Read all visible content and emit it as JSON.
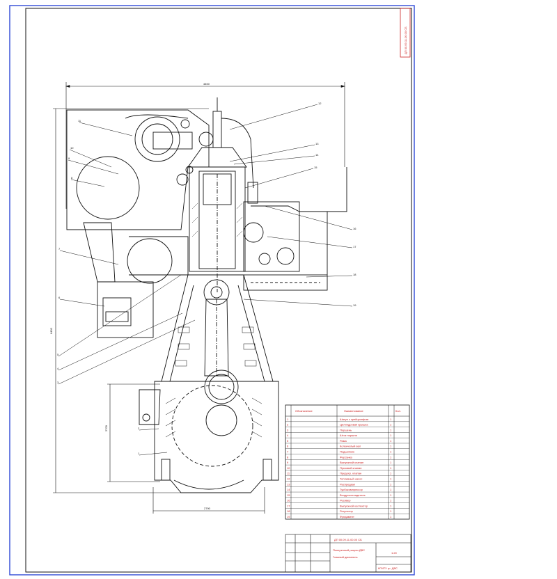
{
  "colors": {
    "outer_frame": "#2f49d6",
    "lines": "#111111",
    "annotation": "#cc2222"
  },
  "drawing": {
    "dim_top": "4400",
    "dim_left": "6450",
    "dim_crank": "2700",
    "dim_bottom": "2790",
    "stamp_vertical": "ДП 00.09.11.00.00 СБ",
    "callouts": [
      "1",
      "2",
      "3",
      "4",
      "5",
      "6",
      "7",
      "8",
      "9",
      "10",
      "11",
      "12",
      "13",
      "14",
      "15",
      "16",
      "17",
      "18",
      "19"
    ]
  },
  "spec_table": {
    "headers": [
      "Обозначение",
      "Наименование",
      "Кол."
    ],
    "rows": [
      "Шатун с крейцкопфом",
      "Цилиндровая крышка",
      "Поршень",
      "Шток поршня",
      "Рама",
      "Коленчатый вал",
      "Подшипник",
      "Форсунка",
      "Выпускной клапан",
      "Пусковой клапан",
      "Предохр. клапан",
      "Топливный насос",
      "Распредвал",
      "Турбокомпрессор",
      "Воздухоохладитель",
      "Ресивер",
      "Выпускной коллектор",
      "Регулятор",
      "Фундамент"
    ],
    "qty": [
      "1",
      "1",
      "1",
      "1",
      "1",
      "1",
      "1",
      "1",
      "1",
      "1",
      "1",
      "1",
      "1",
      "1",
      "1",
      "1",
      "1",
      "1",
      "1"
    ]
  },
  "title_block": {
    "doc_number": "ДП 00.09.11.00.00 СБ",
    "title": "Поперечный разрез ДВС",
    "subtitle": "Главный двигатель",
    "sheet": "1:20",
    "org": "КГМТУ гр. ДВС"
  }
}
